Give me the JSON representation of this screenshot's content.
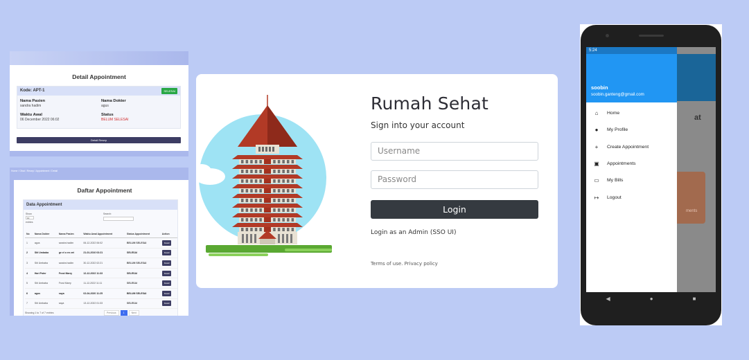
{
  "detail": {
    "title": "Detail Appointment",
    "kode_label": "Kode: APT-1",
    "badge": "SELESAI",
    "pasien_label": "Nama Pasien",
    "pasien_value": "sandra hadim",
    "dokter_label": "Nama Dokter",
    "dokter_value": "agus",
    "waktu_label": "Waktu Awal",
    "waktu_value": "06 December 2022 06:02",
    "status_label": "Status",
    "status_value": "BELUM SELESAI",
    "button": "Detail Resep"
  },
  "daftar": {
    "breadcrumb": "Home / Obat / Resep / Appointment / Detail",
    "title": "Daftar Appointment",
    "section": "Data Appointment",
    "show_label": "Show",
    "show_value": "10",
    "entries_label": "entries",
    "search_label": "Search:",
    "columns": [
      "No",
      "Nama Dokter",
      "Nama Pasien",
      "Waktu Awal Appointment",
      "Status Appointment",
      "Action"
    ],
    "rows": [
      {
        "no": "1",
        "dokter": "agus",
        "pasien": "sandra hadim",
        "waktu": "06-12-2022 06:02",
        "status": "BELUM SELESAI",
        "action": "Detail"
      },
      {
        "no": "2",
        "dokter": "Siti Umbaba",
        "pasien": "ge el o en zet",
        "waktu": "21-01-2010 03:21",
        "status": "SELESAI",
        "action": "Detail"
      },
      {
        "no": "3",
        "dokter": "Siti Umbaba",
        "pasien": "sandra hadim",
        "waktu": "30-12-2022 02:21",
        "status": "BELUM SELESAI",
        "action": "Detail"
      },
      {
        "no": "4",
        "dokter": "Hari Poter",
        "pasien": "Frost Marry",
        "waktu": "12-12-2022 11:33",
        "status": "SELESAI",
        "action": "Detail"
      },
      {
        "no": "5",
        "dokter": "Siti Umbaba",
        "pasien": "Frost Marry",
        "waktu": "11-12-2022 11:11",
        "status": "SELESAI",
        "action": "Detail"
      },
      {
        "no": "6",
        "dokter": "agus",
        "pasien": "saya",
        "waktu": "02-04-2020 11:25",
        "status": "BELUM SELESAI",
        "action": "Detail"
      },
      {
        "no": "7",
        "dokter": "Siti Umbaba",
        "pasien": "saya",
        "waktu": "13-12-2022 01:33",
        "status": "SELESAI",
        "action": "Detail"
      }
    ],
    "showing": "Showing 1 to 7 of 7 entries",
    "prev": "Previous",
    "page": "1",
    "next": "Next"
  },
  "login": {
    "brand": "Rumah Sehat",
    "subtitle": "Sign into your account",
    "username_placeholder": "Username",
    "password_placeholder": "Password",
    "button": "Login",
    "sso": "Login as an Admin (SSO UI)",
    "terms": "Terms of use. Privacy policy"
  },
  "phone": {
    "status_time": "5:24",
    "name": "soobin",
    "email": "soobin.ganteng@gmail.com",
    "menu": [
      {
        "icon": "home-icon",
        "label": "Home"
      },
      {
        "icon": "profile-icon",
        "label": "My Profile"
      },
      {
        "icon": "plus-icon",
        "label": "Create Appointment"
      },
      {
        "icon": "calendar-icon",
        "label": "Appointments"
      },
      {
        "icon": "card-icon",
        "label": "My Bills"
      },
      {
        "icon": "logout-icon",
        "label": "Logout"
      }
    ],
    "behind_text": "at",
    "behind_card": "ments"
  },
  "colors": {
    "background": "#bccbf5",
    "login_button": "#353a40",
    "drawer_header": "#2196f3",
    "status_red": "#d32f2f",
    "status_green": "#2e9e3e"
  }
}
